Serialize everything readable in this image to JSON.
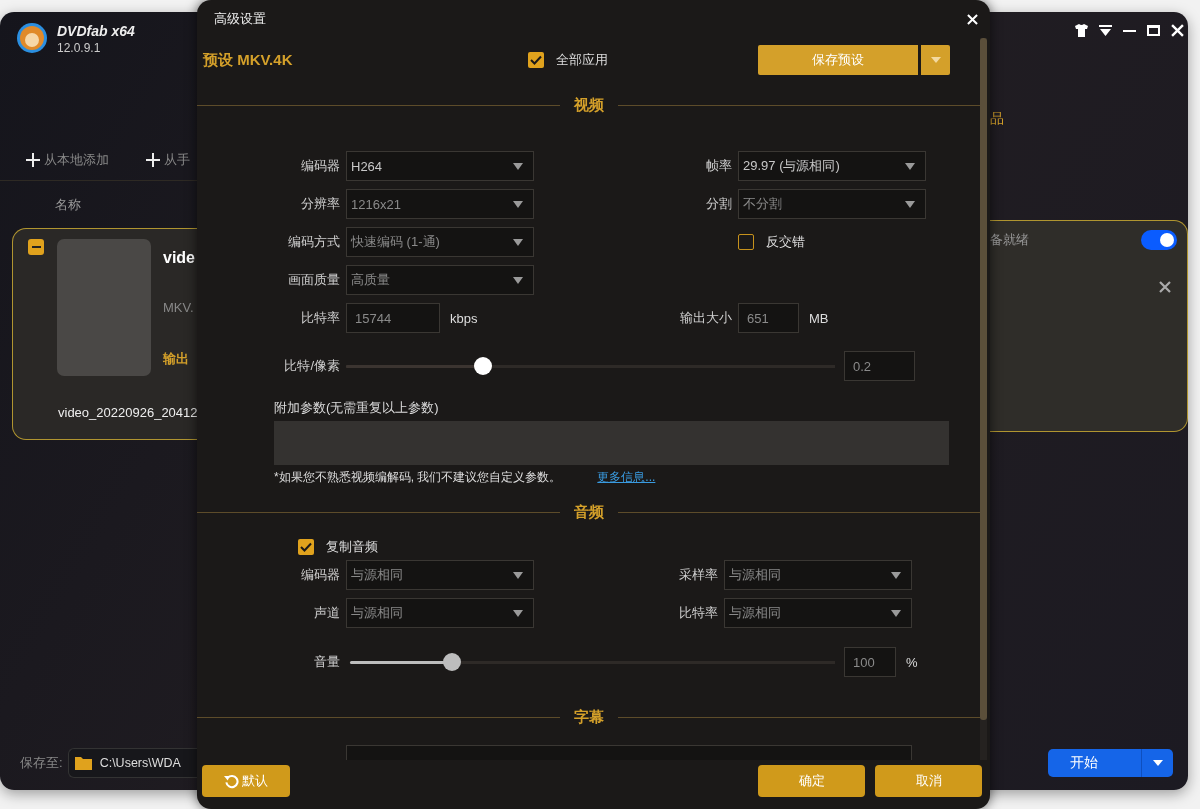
{
  "app": {
    "name": "DVDfab x64",
    "version": "12.0.9.1",
    "add_buttons": [
      {
        "label": "从本地添加"
      },
      {
        "label": "从手"
      }
    ],
    "column_header": "名称",
    "tab_partial": "品",
    "file": {
      "checked": true,
      "title": "vide",
      "format": "MKV.",
      "output": "输出",
      "filename": "video_20220926_20412",
      "status": "备就绪",
      "enabled": true
    },
    "save_to": {
      "label": "保存至:",
      "path": "C:\\Users\\WDA"
    },
    "start_button": "开始"
  },
  "dialog": {
    "title": "高级设置",
    "preset_label": "预设 MKV.4K",
    "apply_all": {
      "label": "全部应用",
      "checked": true
    },
    "save_preset": "保存预设",
    "video": {
      "heading": "视频",
      "rows": [
        [
          {
            "kind": "select",
            "label": "编码器",
            "value": "H264",
            "disabled": false
          },
          {
            "kind": "select",
            "label": "帧率",
            "value": "29.97 (与源相同)",
            "disabled": false
          }
        ],
        [
          {
            "kind": "select",
            "label": "分辨率",
            "value": "1216x21",
            "disabled": true
          },
          {
            "kind": "select",
            "label": "分割",
            "value": "不分割",
            "disabled": true
          }
        ],
        [
          {
            "kind": "select",
            "label": "编码方式",
            "value": "快速编码 (1-通)",
            "disabled": true
          },
          {
            "kind": "checkbox",
            "label": "反交错",
            "checked": false
          }
        ],
        [
          {
            "kind": "select",
            "label": "画面质量",
            "value": "高质量",
            "disabled": true
          }
        ],
        [
          {
            "kind": "input",
            "label": "比特率",
            "value": "15744",
            "unit": "kbps",
            "disabled": true
          },
          {
            "kind": "input",
            "label": "输出大小",
            "value": "651",
            "unit": "MB",
            "disabled": true
          }
        ]
      ],
      "slider": {
        "label": "比特/像素",
        "level": 0.28,
        "value": "0.2"
      },
      "extra_params": {
        "label": "附加参数(无需重复以上参数)"
      },
      "note": "*如果您不熟悉视频编解码, 我们不建议您自定义参数。",
      "link": "更多信息..."
    },
    "audio": {
      "heading": "音频",
      "copy_audio": {
        "label": "复制音频",
        "checked": true
      },
      "rows": [
        [
          {
            "kind": "select",
            "label": "编码器",
            "value": "与源相同",
            "disabled": true
          },
          {
            "kind": "select",
            "label": "采样率",
            "value": "与源相同",
            "disabled": true
          }
        ],
        [
          {
            "kind": "select",
            "label": "声道",
            "value": "与源相同",
            "disabled": true
          },
          {
            "kind": "select",
            "label": "比特率",
            "value": "与源相同",
            "disabled": true
          }
        ]
      ],
      "volume": {
        "label": "音量",
        "level": 0.21,
        "value": "100",
        "unit": "%"
      }
    },
    "subtitle": {
      "heading": "字幕"
    },
    "footer": {
      "default_button": "默认",
      "ok_button": "确定",
      "cancel_button": "取消"
    }
  }
}
